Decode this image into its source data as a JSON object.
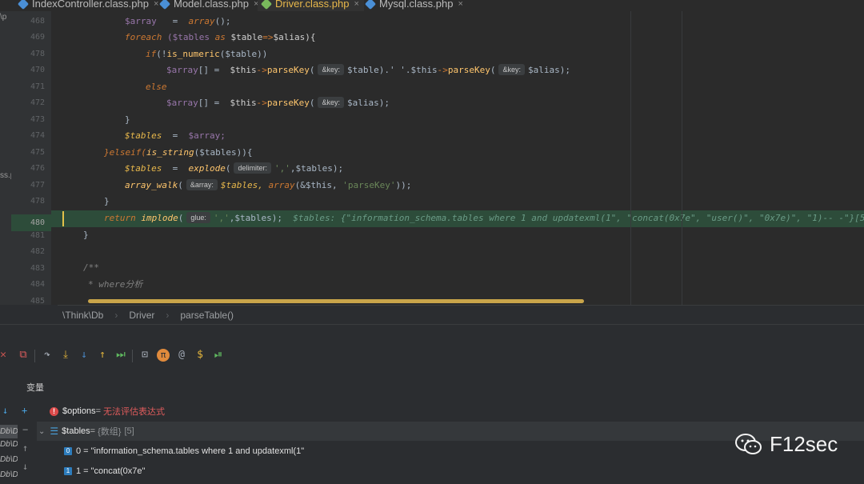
{
  "tabs": [
    {
      "label": "IndexController.class.php",
      "active": false
    },
    {
      "label": "Model.class.php",
      "active": false
    },
    {
      "label": "Driver.class.php",
      "active": true
    },
    {
      "label": "Mysql.class.php",
      "active": false
    }
  ],
  "tab_close": "×",
  "left_fragments": {
    "top": "\\p",
    "mid": "ss.p"
  },
  "line_numbers": [
    "468",
    "469",
    "478",
    "470",
    "471",
    "472",
    "473",
    "474",
    "475",
    "476",
    "477",
    "478",
    "479",
    "480",
    "481",
    "482",
    "483",
    "484",
    "485"
  ],
  "code": {
    "l468": {
      "a": "$array",
      "b": "=",
      "c": "array",
      "d": "();"
    },
    "l469": {
      "a": "foreach",
      "b": "($tables",
      "c": "as",
      "d": "$table",
      "e": "=>",
      "f": "$alias){"
    },
    "l478a": {
      "a": "if",
      "b": "(!",
      "c": "is_numeric",
      "d": "($table))"
    },
    "l470": {
      "a": "$array",
      "b": "[] =",
      "c": "$this",
      "d": "->",
      "e": "parseKey",
      "f": "(",
      "hint": "&key:",
      "g": "$table).'",
      "h": "'.$this",
      "i": "->",
      "j": "parseKey",
      "k": "(",
      "hint2": "&key:",
      "l": "$alias);"
    },
    "l471": {
      "a": "else"
    },
    "l472": {
      "a": "$array",
      "b": "[] =",
      "c": "$this",
      "d": "->",
      "e": "parseKey",
      "f": "(",
      "hint": "&key:",
      "g": "$alias);"
    },
    "l473": {
      "a": "}"
    },
    "l474": {
      "a": "$tables",
      "b": "=",
      "c": "$array;"
    },
    "l475": {
      "a": "}elseif(",
      "b": "is_string",
      "c": "($tables)){"
    },
    "l476": {
      "a": "$tables",
      "b": "=",
      "c": "explode",
      "d": "(",
      "hint": "delimiter:",
      "e": "','",
      "f": ",$tables);"
    },
    "l477": {
      "a": "array_walk",
      "b": "(",
      "hint": "&array:",
      "c": "$tables,",
      "d": "array",
      "e": "(&$this,",
      "f": "'parseKey'",
      "g": "));"
    },
    "l478": {
      "a": "}"
    },
    "l479": {
      "a": "return",
      "b": "implode",
      "c": "(",
      "hint": "glue:",
      "d": "','",
      "e": ",$tables);",
      "debug": "$tables: {\"information_schema.tables where 1 and updatexml(1\", \"concat(0x7e\", \"user()\", \"0x7e)\", \"1)-- -\"}[5]"
    },
    "l480": {
      "a": "}"
    },
    "l482": {
      "a": "/**"
    },
    "l483": {
      "a": "* where分析"
    }
  },
  "breadcrumb": [
    "\\Think\\Db",
    "Driver",
    "parseTable()"
  ],
  "debug_toolbar": [
    {
      "name": "close-icon",
      "glyph": "✕",
      "color": "#c75450"
    },
    {
      "name": "stop-icon",
      "glyph": "⧉",
      "color": "#db5c5c"
    },
    {
      "name": "step-over-icon",
      "glyph": "↷",
      "color": "#b0b7c1"
    },
    {
      "name": "step-into-icon",
      "glyph": "⤓",
      "color": "#e2b43c"
    },
    {
      "name": "force-step-into-icon",
      "glyph": "↓",
      "color": "#4a88c7"
    },
    {
      "name": "step-out-icon",
      "glyph": "↑",
      "color": "#e2b43c"
    },
    {
      "name": "run-to-cursor-icon",
      "glyph": "⏭",
      "color": "#5fb85f"
    },
    {
      "name": "evaluate-icon",
      "glyph": "⊡",
      "color": "#b0b7c1"
    },
    {
      "name": "pi-icon",
      "glyph": "π",
      "color": "#e08a3c"
    },
    {
      "name": "at-icon",
      "glyph": "@",
      "color": "#a0a8b3"
    },
    {
      "name": "dollar-icon",
      "glyph": "$",
      "color": "#e2b43c"
    },
    {
      "name": "resume-icon",
      "glyph": "⏯",
      "color": "#5fb85f"
    }
  ],
  "variables_title": "变量",
  "variables": {
    "options": {
      "name": "$options",
      "eq": " = ",
      "value": "无法评估表达式"
    },
    "tables": {
      "name": "$tables",
      "eq": " = ",
      "type": "{数组}",
      "count": "[5]"
    },
    "items": [
      {
        "index": "0",
        "text": "0 = \"information_schema.tables where 1 and updatexml(1\""
      },
      {
        "index": "1",
        "text": "1 = \"concat(0x7e\""
      }
    ]
  },
  "frames": [
    "Db\\D",
    "Db\\D",
    "Db\\D",
    "Db\\D"
  ],
  "watermark": "F12sec",
  "colors": {
    "highlight": "#2d4c3a",
    "accent": "#4a88c7",
    "error": "#db4a4a"
  }
}
